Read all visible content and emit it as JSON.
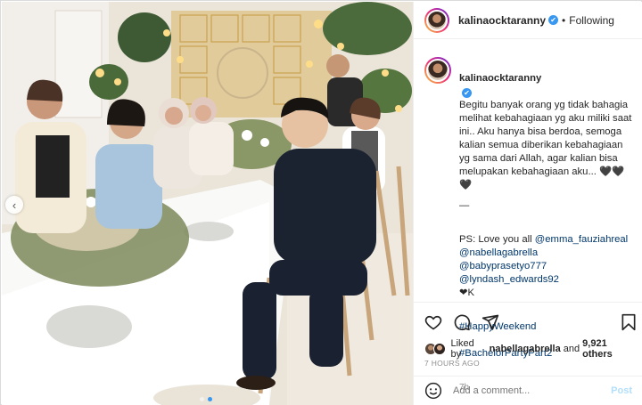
{
  "header": {
    "username": "kalinaocktaranny",
    "verified": "✔",
    "separator": "•",
    "follow_state": "Following"
  },
  "caption": {
    "username": "kalinaocktaranny",
    "body": "Begitu banyak orang yg tidak bahagia melihat kebahagiaan yg aku miliki saat ini.. Aku hanya bisa berdoa, semoga kalian semua diberikan kebahagiaan yg sama dari Allah, agar kalian bisa melupakan kebahagiaan aku... 🖤🖤🖤",
    "dash": "—",
    "ps_prefix": "PS: Love you all ",
    "mentions": [
      "@emma_fauziahreal",
      "@nabellagabrella",
      "@babyprasetyo777",
      "@lyndash_edwards92"
    ],
    "heart": "❤K",
    "hashtags": [
      "#HappyWeekend",
      "#BachelorPartyPart2"
    ],
    "age": "7h"
  },
  "actions": {
    "like_icon": "heart-icon",
    "comment_icon": "comment-icon",
    "share_icon": "send-icon",
    "save_icon": "bookmark-icon"
  },
  "likes": {
    "prefix": "Liked by ",
    "user": "nabellagabrella",
    "middle": " and ",
    "count": "9,921 others"
  },
  "timestamp": "7 HOURS AGO",
  "comment": {
    "placeholder": "Add a comment...",
    "post_label": "Post"
  },
  "carousel": {
    "prev_icon": "chevron-left-icon",
    "prev_glyph": "‹",
    "total_slides": 2,
    "active_slide": 2
  },
  "colors": {
    "link": "#00376b",
    "accent": "#3897f0",
    "muted": "#8e8e8e",
    "post_disabled": "#b2dffc"
  }
}
